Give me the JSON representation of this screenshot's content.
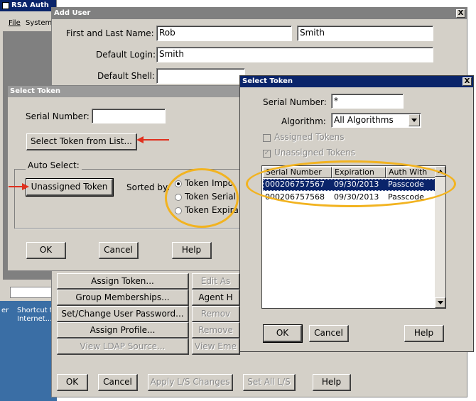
{
  "background_window": {
    "title": "RSA Auth",
    "menu": [
      "File",
      "System"
    ],
    "side_text_1": "er",
    "side_text_2": "Shortcut t",
    "side_text_3": "Internet..."
  },
  "add_user": {
    "title": "Add User",
    "close": "X",
    "first_last_label": "First and Last Name:",
    "first_name": "Rob",
    "last_name": "Smith",
    "default_login_label": "Default Login:",
    "default_login": "Smith",
    "default_shell_label": "Default Shell:",
    "buttons": {
      "assign_token": "Assign Token...",
      "group_memberships": "Group Memberships...",
      "set_change_password": "Set/Change User Password...",
      "assign_profile": "Assign Profile...",
      "view_ldap_source": "View LDAP Source...",
      "edit_as": "Edit As",
      "agent_h": "Agent H",
      "remov": "Remov",
      "remove_": "Remove",
      "view_eme": "View Eme",
      "ok": "OK",
      "cancel": "Cancel",
      "apply_ls": "Apply L/S Changes",
      "set_all_ls": "Set All L/S",
      "help": "Help"
    }
  },
  "select_token_left": {
    "title": "Select Token",
    "serial_label": "Serial Number:",
    "serial_value": "",
    "select_from_list": "Select Token from List...",
    "auto_select_label": "Auto Select:",
    "unassigned_token": "Unassigned Token",
    "sorted_by_label": "Sorted by:",
    "radio_options": [
      "Token Impo",
      "Token Serial",
      "Token Expira"
    ],
    "ok": "OK",
    "cancel": "Cancel",
    "help": "Help"
  },
  "select_token_right": {
    "title": "Select Token",
    "close": "X",
    "serial_label": "Serial Number:",
    "serial_value": "*",
    "algorithm_label": "Algorithm:",
    "algorithm_value": "All Algorithms",
    "assigned_tokens": "Assigned Tokens",
    "unassigned_tokens": "Unassigned Tokens",
    "columns": [
      "Serial Number",
      "Expiration",
      "Auth With"
    ],
    "rows": [
      [
        "000206757567",
        "09/30/2013",
        "Passcode"
      ],
      [
        "000206757568",
        "09/30/2013",
        "Passcode"
      ]
    ],
    "ok": "OK",
    "cancel": "Cancel",
    "help": "Help"
  },
  "colors": {
    "highlight_ellipse": "#f2b320",
    "arrow": "#e0301e",
    "selection": "#0a246a",
    "desktop": "#3a6ea5"
  }
}
